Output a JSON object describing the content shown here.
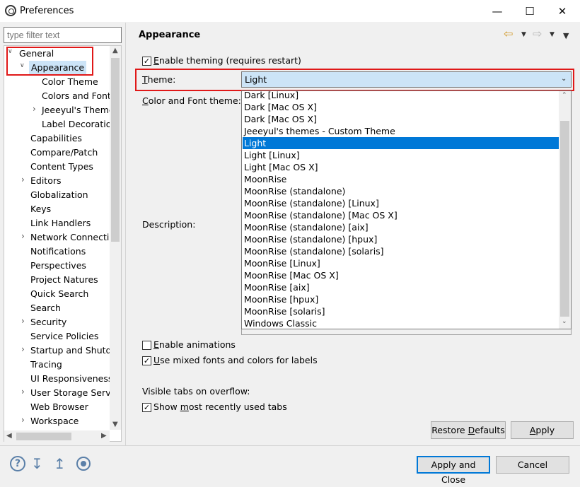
{
  "window": {
    "title": "Preferences",
    "minimize": "—",
    "maximize": "☐",
    "close": "✕"
  },
  "filter": {
    "placeholder": "type filter text"
  },
  "tree": {
    "items": [
      {
        "label": "General",
        "expander": "∨"
      },
      {
        "label": "Appearance",
        "expander": "∨"
      },
      {
        "label": "Color Theme",
        "expander": ""
      },
      {
        "label": "Colors and Fonts",
        "expander": ""
      },
      {
        "label": "Jeeeyul's Themes",
        "expander": "›"
      },
      {
        "label": "Label Decorations",
        "expander": ""
      },
      {
        "label": "Capabilities",
        "expander": ""
      },
      {
        "label": "Compare/Patch",
        "expander": ""
      },
      {
        "label": "Content Types",
        "expander": ""
      },
      {
        "label": "Editors",
        "expander": "›"
      },
      {
        "label": "Globalization",
        "expander": ""
      },
      {
        "label": "Keys",
        "expander": ""
      },
      {
        "label": "Link Handlers",
        "expander": ""
      },
      {
        "label": "Network Connections",
        "expander": "›"
      },
      {
        "label": "Notifications",
        "expander": ""
      },
      {
        "label": "Perspectives",
        "expander": ""
      },
      {
        "label": "Project Natures",
        "expander": ""
      },
      {
        "label": "Quick Search",
        "expander": ""
      },
      {
        "label": "Search",
        "expander": ""
      },
      {
        "label": "Security",
        "expander": "›"
      },
      {
        "label": "Service Policies",
        "expander": ""
      },
      {
        "label": "Startup and Shutdown",
        "expander": "›"
      },
      {
        "label": "Tracing",
        "expander": ""
      },
      {
        "label": "UI Responsiveness",
        "expander": ""
      },
      {
        "label": "User Storage Service",
        "expander": "›"
      },
      {
        "label": "Web Browser",
        "expander": ""
      },
      {
        "label": "Workspace",
        "expander": "›"
      }
    ],
    "selected": "Appearance"
  },
  "page": {
    "title": "Appearance",
    "enable_theming": {
      "label_u": "E",
      "label_rest": "nable theming (requires restart)",
      "checked": true
    },
    "theme": {
      "label_u": "T",
      "label_rest": "heme:",
      "value": "Light"
    },
    "color_font_theme": {
      "label_u": "C",
      "label_rest": "olor and Font theme:"
    },
    "description_label": "Description:",
    "theme_options": [
      "Dark [Linux]",
      "Dark [Mac OS X]",
      "Dark [Mac OS X]",
      "Jeeeyul's themes - Custom Theme",
      "Light",
      "Light [Linux]",
      "Light [Mac OS X]",
      "MoonRise",
      "MoonRise (standalone)",
      "MoonRise (standalone) [Linux]",
      "MoonRise (standalone) [Mac OS X]",
      "MoonRise (standalone) [aix]",
      "MoonRise (standalone) [hpux]",
      "MoonRise (standalone) [solaris]",
      "MoonRise [Linux]",
      "MoonRise [Mac OS X]",
      "MoonRise [aix]",
      "MoonRise [hpux]",
      "MoonRise [solaris]",
      "Windows Classic"
    ],
    "selected_option": "Light",
    "enable_animations": {
      "label_u": "E",
      "label_rest": "nable animations",
      "checked": false
    },
    "mixed_fonts": {
      "label_u": "U",
      "label_rest": "se mixed fonts and colors for labels",
      "checked": true
    },
    "visible_tabs_label": "Visible tabs on overflow:",
    "show_recent": {
      "label_pre": "Show ",
      "label_u": "m",
      "label_rest": "ost recently used tabs",
      "checked": true
    },
    "restore_defaults": {
      "pre": "Restore ",
      "u": "D",
      "rest": "efaults"
    },
    "apply": {
      "u": "A",
      "rest": "pply"
    }
  },
  "footer": {
    "apply_close": "Apply and Close",
    "cancel": "Cancel",
    "icons": [
      "help-icon",
      "import-icon",
      "export-icon",
      "record-icon"
    ]
  },
  "colors": {
    "highlight_red": "#e01818",
    "selection_blue": "#0078d7",
    "tree_selected_bg": "#cce4f7"
  }
}
